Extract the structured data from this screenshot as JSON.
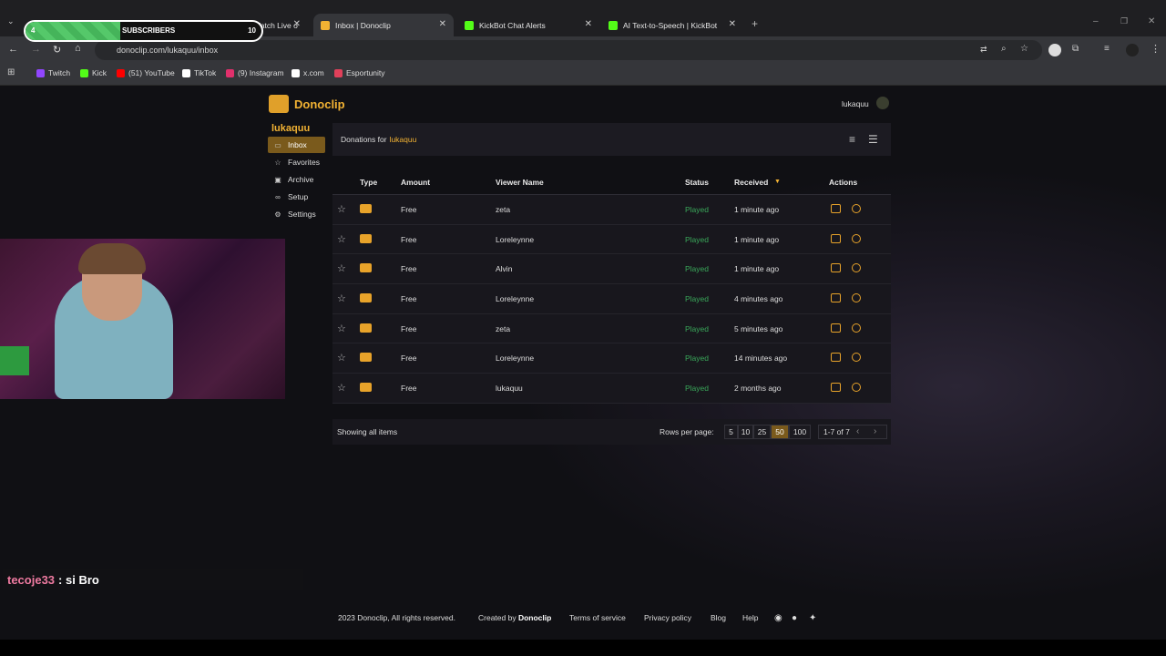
{
  "browser": {
    "tabs": [
      {
        "title": "About LuKaQuu - Watch Live o",
        "color": "#53fc18"
      },
      {
        "title": "Inbox | Donoclip",
        "color": "#f2b233"
      },
      {
        "title": "KickBot Chat Alerts",
        "color": "#53fc18"
      },
      {
        "title": "AI Text-to-Speech | KickBot",
        "color": "#53fc18"
      }
    ],
    "url": "donoclip.com/lukaquu/inbox",
    "bookmarks": [
      {
        "label": "Twitch",
        "color": "#9146ff"
      },
      {
        "label": "Kick",
        "color": "#53fc18"
      },
      {
        "label": "(51) YouTube",
        "color": "#ff0000"
      },
      {
        "label": "TikTok",
        "color": "#ffffff"
      },
      {
        "label": "(9) Instagram",
        "color": "#e1306c"
      },
      {
        "label": "x.com",
        "color": "#ffffff"
      },
      {
        "label": "Esportunity",
        "color": "#e0405a"
      }
    ]
  },
  "overlay": {
    "subs_current": "4",
    "subs_label": "SUBSCRIBERS",
    "subs_target": "10",
    "subs_progress": 0.4,
    "chat_user": "tecoje33",
    "chat_text": ": si Bro"
  },
  "app": {
    "brand": "Donoclip",
    "header_user": "lukaquu",
    "sidebar_user": "lukaquu",
    "nav": [
      {
        "label": "Inbox",
        "icon": "inbox-icon",
        "active": true
      },
      {
        "label": "Favorites",
        "icon": "star-icon",
        "active": false
      },
      {
        "label": "Archive",
        "icon": "archive-icon",
        "active": false
      },
      {
        "label": "Setup",
        "icon": "link-icon",
        "active": false
      },
      {
        "label": "Settings",
        "icon": "gear-icon",
        "active": false
      }
    ],
    "panel_prefix": "Donations for",
    "panel_user": "lukaquu",
    "columns": {
      "type": "Type",
      "amount": "Amount",
      "viewer": "Viewer Name",
      "status": "Status",
      "received": "Received",
      "actions": "Actions"
    },
    "rows": [
      {
        "amount": "Free",
        "viewer": "zeta",
        "status": "Played",
        "received": "1 minute ago"
      },
      {
        "amount": "Free",
        "viewer": "Loreleynne",
        "status": "Played",
        "received": "1 minute ago"
      },
      {
        "amount": "Free",
        "viewer": "Alvin",
        "status": "Played",
        "received": "1 minute ago"
      },
      {
        "amount": "Free",
        "viewer": "Loreleynne",
        "status": "Played",
        "received": "4 minutes ago"
      },
      {
        "amount": "Free",
        "viewer": "zeta",
        "status": "Played",
        "received": "5 minutes ago"
      },
      {
        "amount": "Free",
        "viewer": "Loreleynne",
        "status": "Played",
        "received": "14 minutes ago"
      },
      {
        "amount": "Free",
        "viewer": "lukaquu",
        "status": "Played",
        "received": "2 months ago"
      }
    ],
    "footer_left": "Showing all items",
    "rows_per_page_label": "Rows per page:",
    "page_sizes": [
      "5",
      "10",
      "25",
      "50",
      "100"
    ],
    "selected_page_size": "50",
    "range": "1-7 of 7"
  },
  "site_footer": {
    "copyright": "2023 Donoclip, All rights reserved.",
    "created_by": "Created by",
    "created_by_name": "Donoclip",
    "terms": "Terms of service",
    "privacy": "Privacy policy",
    "blog": "Blog",
    "help": "Help"
  }
}
